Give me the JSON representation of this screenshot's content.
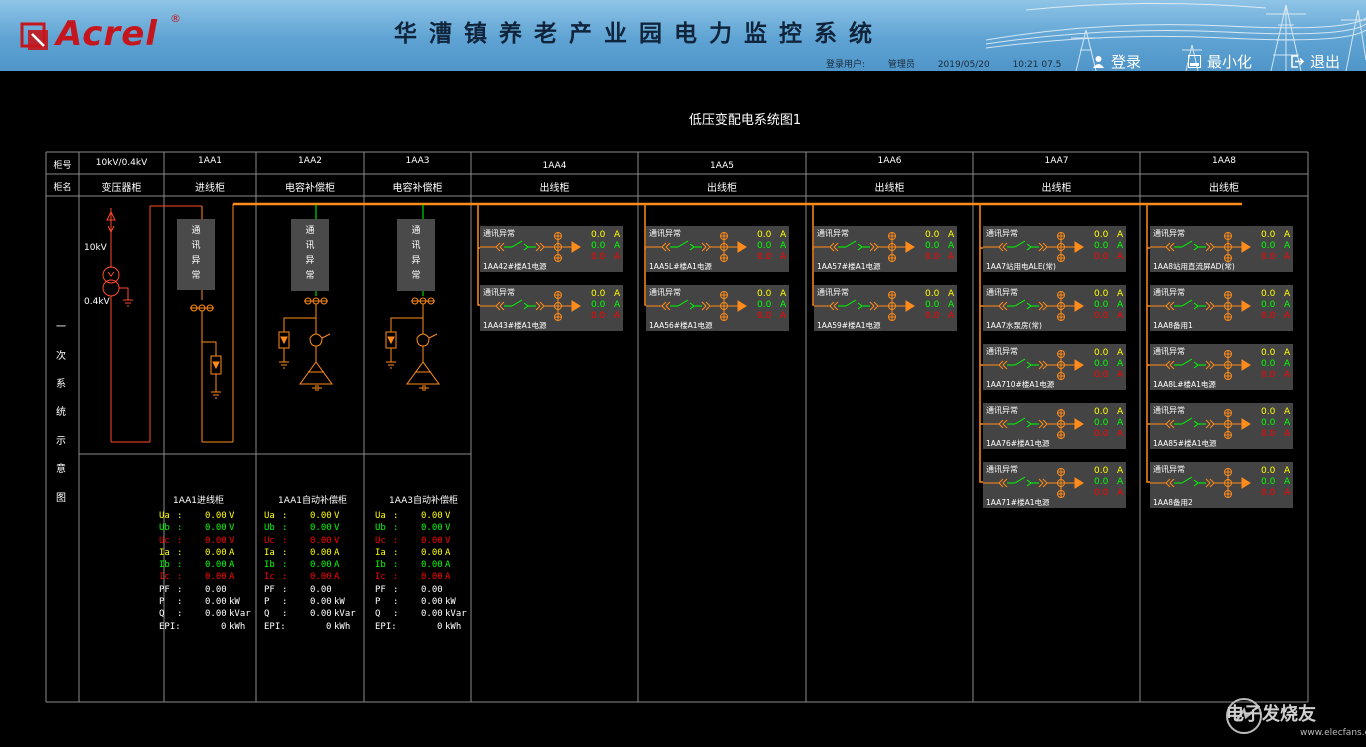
{
  "header": {
    "logo_text": "Acrel",
    "logo_reg": "®",
    "title": "华漕镇养老产业园电力监控系统",
    "status": {
      "user_label": "登录用户:",
      "user_name": "管理员",
      "date": "2019/05/20",
      "time": "10:21 07.5"
    },
    "buttons": {
      "login": "登录",
      "minimize": "最小化",
      "exit": "退出"
    },
    "colors": {
      "bar": "#5ea3d3",
      "logo": "#c4161c"
    }
  },
  "page_title": "低压变配电系统图1",
  "table": {
    "row_labels": {
      "number": "柜号",
      "name": "柜名"
    },
    "side_label": [
      "一",
      "次",
      "系",
      "统",
      "示",
      "意",
      "图"
    ],
    "columns": [
      {
        "number": "10kV/0.4kV",
        "name": "变压器柜"
      },
      {
        "number": "1AA1",
        "name": "进线柜"
      },
      {
        "number": "1AA2",
        "name": "电容补偿柜"
      },
      {
        "number": "1AA3",
        "name": "电容补偿柜"
      },
      {
        "number": "1AA4",
        "name": "出线柜"
      },
      {
        "number": "1AA5",
        "name": "出线柜"
      },
      {
        "number": "1AA6",
        "name": "出线柜"
      },
      {
        "number": "1AA7",
        "name": "出线柜"
      },
      {
        "number": "1AA8",
        "name": "出线柜"
      }
    ]
  },
  "transformer": {
    "hv": "10kV",
    "lv": "0.4kV"
  },
  "comm_vertical": [
    "通",
    "讯",
    "异",
    "常"
  ],
  "feeder_common": {
    "comm": "通讯异常",
    "value": "0.0",
    "unit": "A"
  },
  "feeders": {
    "aa4": [
      "1AA42#楼A1电源",
      "1AA43#楼A1电源"
    ],
    "aa5": [
      "1AA5L#楼A1电源",
      "1AA56#楼A1电源"
    ],
    "aa6": [
      "1AA57#楼A1电源",
      "1AA59#楼A1电源"
    ],
    "aa7": [
      "1AA7站用电ALE(常)",
      "1AA7水泵房(常)",
      "1AA710#楼A1电源",
      "1AA76#楼A1电源",
      "1AA71#楼A1电源"
    ],
    "aa8": [
      "1AA8站用直流屏AD(常)",
      "1AA8备用1",
      "1AA8L#楼A1电源",
      "1AA85#楼A1电源",
      "1AA8备用2"
    ]
  },
  "meters": [
    {
      "title": "1AA1进线柜",
      "rows": [
        {
          "label": "Ua",
          "value": "0.00",
          "unit": "V",
          "color": "#ffff00"
        },
        {
          "label": "Ub",
          "value": "0.00",
          "unit": "V",
          "color": "#00ff00"
        },
        {
          "label": "Uc",
          "value": "0.00",
          "unit": "V",
          "color": "#ff0000"
        },
        {
          "label": "Ia",
          "value": "0.00",
          "unit": "A",
          "color": "#ffff00"
        },
        {
          "label": "Ib",
          "value": "0.00",
          "unit": "A",
          "color": "#00ff00"
        },
        {
          "label": "Ic",
          "value": "0.00",
          "unit": "A",
          "color": "#ff0000"
        },
        {
          "label": "PF",
          "value": "0.00",
          "unit": "",
          "color": "#ffffff"
        },
        {
          "label": "P",
          "value": "0.00",
          "unit": "kW",
          "color": "#ffffff"
        },
        {
          "label": "Q",
          "value": "0.00",
          "unit": "kVar",
          "color": "#ffffff"
        },
        {
          "label": "EPI:",
          "value": "0",
          "unit": "kWh",
          "color": "#ffffff"
        }
      ]
    },
    {
      "title": "1AA1自动补偿柜",
      "rows": [
        {
          "label": "Ua",
          "value": "0.00",
          "unit": "V",
          "color": "#ffff00"
        },
        {
          "label": "Ub",
          "value": "0.00",
          "unit": "V",
          "color": "#00ff00"
        },
        {
          "label": "Uc",
          "value": "0.00",
          "unit": "V",
          "color": "#ff0000"
        },
        {
          "label": "Ia",
          "value": "0.00",
          "unit": "A",
          "color": "#ffff00"
        },
        {
          "label": "Ib",
          "value": "0.00",
          "unit": "A",
          "color": "#00ff00"
        },
        {
          "label": "Ic",
          "value": "0.00",
          "unit": "A",
          "color": "#ff0000"
        },
        {
          "label": "PF",
          "value": "0.00",
          "unit": "",
          "color": "#ffffff"
        },
        {
          "label": "P",
          "value": "0.00",
          "unit": "kW",
          "color": "#ffffff"
        },
        {
          "label": "Q",
          "value": "0.00",
          "unit": "kVar",
          "color": "#ffffff"
        },
        {
          "label": "EPI:",
          "value": "0",
          "unit": "kWh",
          "color": "#ffffff"
        }
      ]
    },
    {
      "title": "1AA3自动补偿柜",
      "rows": [
        {
          "label": "Ua",
          "value": "0.00",
          "unit": "V",
          "color": "#ffff00"
        },
        {
          "label": "Ub",
          "value": "0.00",
          "unit": "V",
          "color": "#00ff00"
        },
        {
          "label": "Uc",
          "value": "0.00",
          "unit": "V",
          "color": "#ff0000"
        },
        {
          "label": "Ia",
          "value": "0.00",
          "unit": "A",
          "color": "#ffff00"
        },
        {
          "label": "Ib",
          "value": "0.00",
          "unit": "A",
          "color": "#00ff00"
        },
        {
          "label": "Ic",
          "value": "0.00",
          "unit": "A",
          "color": "#ff0000"
        },
        {
          "label": "PF",
          "value": "0.00",
          "unit": "",
          "color": "#ffffff"
        },
        {
          "label": "P",
          "value": "0.00",
          "unit": "kW",
          "color": "#ffffff"
        },
        {
          "label": "Q",
          "value": "0.00",
          "unit": "kVar",
          "color": "#ffffff"
        },
        {
          "label": "EPI:",
          "value": "0",
          "unit": "kWh",
          "color": "#ffffff"
        }
      ]
    }
  ],
  "colors": {
    "bus": "#ff8c1a",
    "ok": "#00ff00",
    "alarm": "#ff0000",
    "phase_a": "#ffff00"
  },
  "watermark": {
    "text": "电子发烧友",
    "url": "www.elecfans.com"
  }
}
